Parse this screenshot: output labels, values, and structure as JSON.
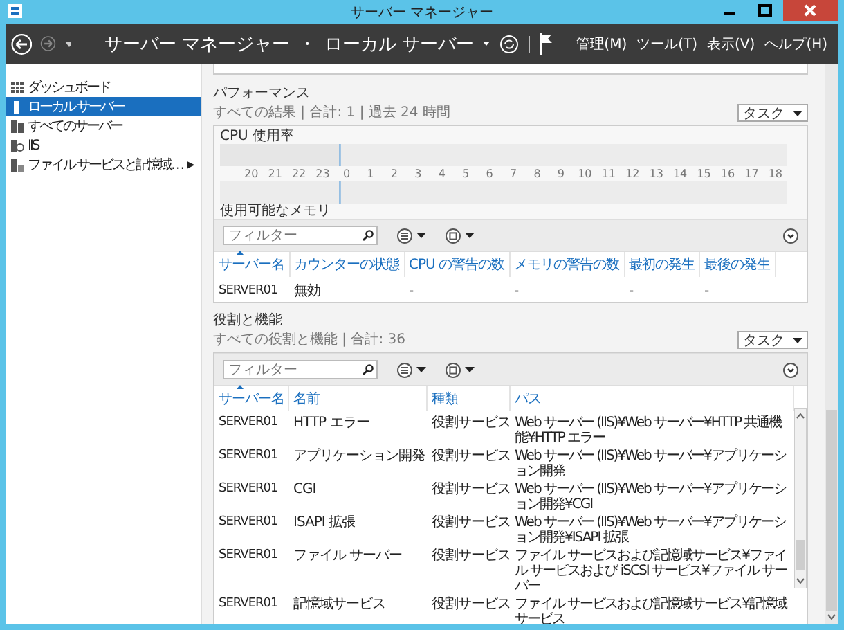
{
  "window": {
    "title": "サーバー マネージャー"
  },
  "header": {
    "breadcrumb": [
      "サーバー マネージャー",
      "ローカル サーバー"
    ],
    "separator": "・",
    "menus": [
      "管理(M)",
      "ツール(T)",
      "表示(V)",
      "ヘルプ(H)"
    ]
  },
  "sidebar": {
    "items": [
      {
        "label": "ダッシュボード",
        "kind": "dashboard",
        "selected": false
      },
      {
        "label": "ローカル サーバー",
        "kind": "server",
        "selected": true
      },
      {
        "label": "すべてのサーバー",
        "kind": "servers",
        "selected": false
      },
      {
        "label": "IIS",
        "kind": "iis",
        "selected": false
      },
      {
        "label": "ファイル サービスと記憶域…",
        "kind": "storage",
        "selected": false,
        "arrow": "▶"
      }
    ]
  },
  "performance": {
    "title": "パフォーマンス",
    "subtitle": "すべての結果 | 合計: 1 | 過去 24 時間",
    "task_button": "タスク",
    "cpu_label": "CPU 使用率",
    "axis_labels": [
      "20",
      "21",
      "22",
      "23",
      "0",
      "1",
      "2",
      "3",
      "4",
      "5",
      "6",
      "7",
      "8",
      "9",
      "10",
      "11",
      "12",
      "13",
      "14",
      "15",
      "16",
      "17",
      "18"
    ],
    "memory_label": "使用可能なメモリ",
    "filter_placeholder": "フィルター",
    "columns": [
      {
        "label": "サーバー名",
        "sorted": true
      },
      {
        "label": "カウンターの状態",
        "sorted": false
      },
      {
        "label": "CPU の警告の数",
        "sorted": false
      },
      {
        "label": "メモリの警告の数",
        "sorted": false
      },
      {
        "label": "最初の発生",
        "sorted": false
      },
      {
        "label": "最後の発生",
        "sorted": false
      }
    ],
    "rows": [
      [
        "SERVER01",
        "無効",
        "-",
        "-",
        "-",
        "-"
      ]
    ]
  },
  "roles": {
    "title": "役割と機能",
    "subtitle": "すべての役割と機能 | 合計: 36",
    "task_button": "タスク",
    "filter_placeholder": "フィルター",
    "columns": [
      {
        "label": "サーバー名",
        "sorted": true
      },
      {
        "label": "名前",
        "sorted": false
      },
      {
        "label": "種類",
        "sorted": false
      },
      {
        "label": "パス",
        "sorted": false
      }
    ],
    "rows": [
      [
        "SERVER01",
        "HTTP エラー",
        "役割サービス",
        "Web サーバー (IIS)¥Web サーバー¥HTTP 共通機能¥HTTP エラー"
      ],
      [
        "SERVER01",
        "アプリケーション開発",
        "役割サービス",
        "Web サーバー (IIS)¥Web サーバー¥アプリケーション開発"
      ],
      [
        "SERVER01",
        "CGI",
        "役割サービス",
        "Web サーバー (IIS)¥Web サーバー¥アプリケーション開発¥CGI"
      ],
      [
        "SERVER01",
        "ISAPI 拡張",
        "役割サービス",
        "Web サーバー (IIS)¥Web サーバー¥アプリケーション開発¥ISAPI 拡張"
      ],
      [
        "SERVER01",
        "ファイル サーバー",
        "役割サービス",
        "ファイル サービスおよび記憶域サービス¥ファイル サービスおよび iSCSI サービス¥ファイル サーバー"
      ],
      [
        "SERVER01",
        "記憶域サービス",
        "役割サービス",
        "ファイル サービスおよび記憶域サービス¥記憶域サービス"
      ]
    ]
  }
}
